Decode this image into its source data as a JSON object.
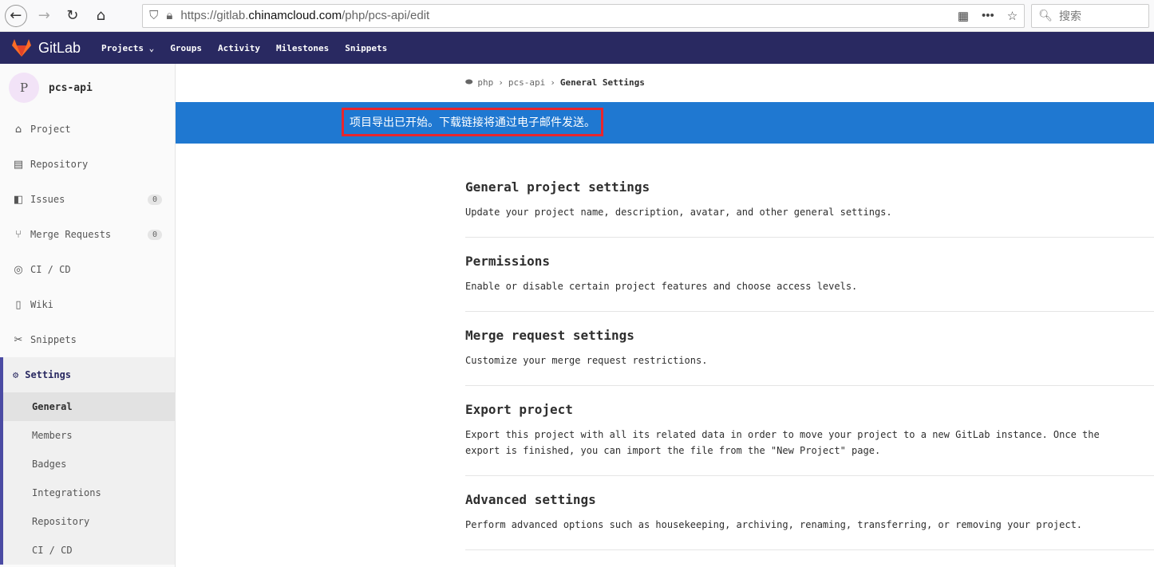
{
  "browser": {
    "url_prefix": "https://gitlab.",
    "url_domain": "chinamcloud.com",
    "url_path": "/php/pcs-api/edit",
    "search_placeholder": "搜索"
  },
  "nav": {
    "brand": "GitLab",
    "links": [
      "Projects ⌄",
      "Groups",
      "Activity",
      "Milestones",
      "Snippets"
    ]
  },
  "sidebar": {
    "avatar_letter": "P",
    "project": "pcs-api",
    "items": [
      {
        "label": "Project",
        "icon": "⌂"
      },
      {
        "label": "Repository",
        "icon": "▤"
      },
      {
        "label": "Issues",
        "icon": "◧",
        "badge": "0"
      },
      {
        "label": "Merge Requests",
        "icon": "⑂",
        "badge": "0"
      },
      {
        "label": "CI / CD",
        "icon": "◎"
      },
      {
        "label": "Wiki",
        "icon": "▯"
      },
      {
        "label": "Snippets",
        "icon": "✂"
      }
    ],
    "settings": {
      "label": "Settings",
      "icon": "⚙",
      "subs": [
        "General",
        "Members",
        "Badges",
        "Integrations",
        "Repository",
        "CI / CD"
      ]
    }
  },
  "breadcrumb": {
    "group": "php",
    "project": "pcs-api",
    "current": "General Settings"
  },
  "flash": "项目导出已开始。下载链接将通过电子邮件发送。",
  "sections": [
    {
      "title": "General project settings",
      "desc": "Update your project name, description, avatar, and other general settings."
    },
    {
      "title": "Permissions",
      "desc": "Enable or disable certain project features and choose access levels."
    },
    {
      "title": "Merge request settings",
      "desc": "Customize your merge request restrictions."
    },
    {
      "title": "Export project",
      "desc": "Export this project with all its related data in order to move your project to a new GitLab instance. Once the export is finished, you can import the file from the \"New Project\" page."
    },
    {
      "title": "Advanced settings",
      "desc": "Perform advanced options such as housekeeping, archiving, renaming, transferring, or removing your project."
    }
  ]
}
